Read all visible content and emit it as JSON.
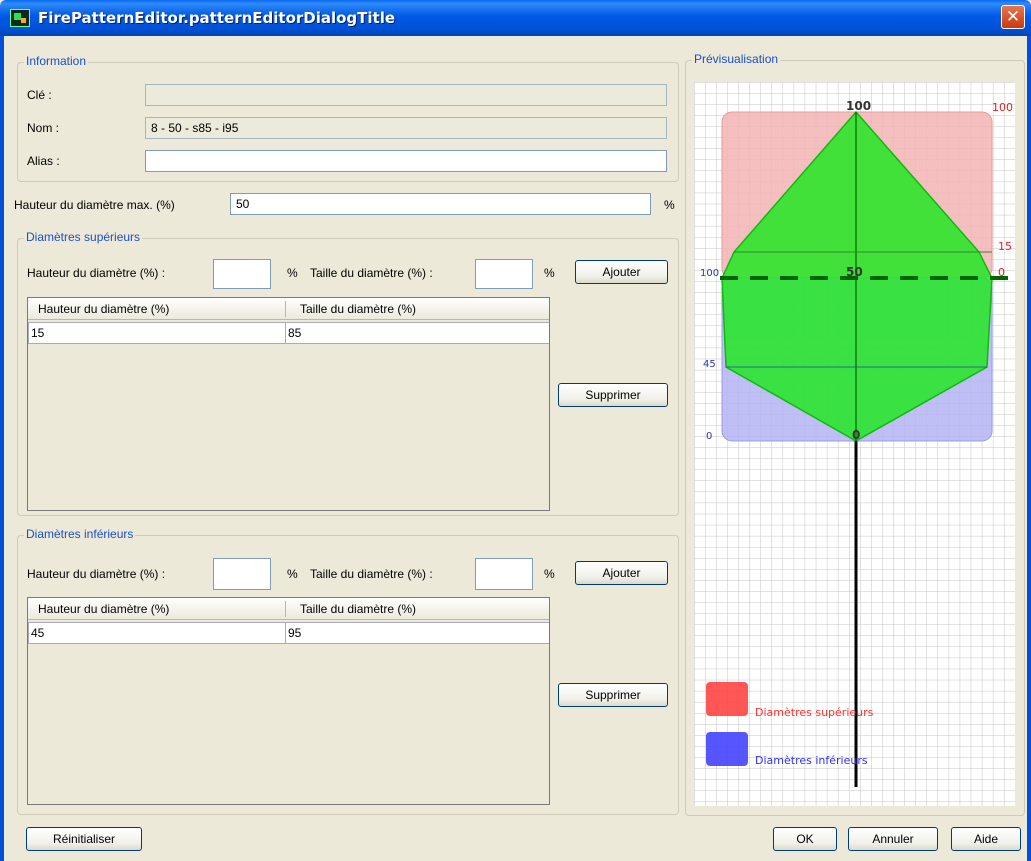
{
  "window": {
    "title": "FirePatternEditor.patternEditorDialogTitle",
    "close_glyph": "✕"
  },
  "information": {
    "group_label": "Information",
    "key_label": "Clé :",
    "key_value": "",
    "name_label": "Nom :",
    "name_value": "8 - 50 - s85 - i95",
    "alias_label": "Alias :",
    "alias_value": ""
  },
  "max_height": {
    "label": "Hauteur du diamètre max. (%)",
    "value": "50",
    "unit": "%"
  },
  "upper": {
    "group_label": "Diamètres supérieurs",
    "height_label": "Hauteur du diamètre (%) :",
    "height_value": "",
    "unit1": "%",
    "size_label": "Taille du diamètre (%) :",
    "size_value": "",
    "unit2": "%",
    "add_label": "Ajouter",
    "remove_label": "Supprimer",
    "columns": [
      "Hauteur du diamètre (%)",
      "Taille du diamètre (%)"
    ],
    "rows": [
      [
        "15",
        "85"
      ]
    ]
  },
  "lower": {
    "group_label": "Diamètres inférieurs",
    "height_label": "Hauteur du diamètre (%) :",
    "height_value": "",
    "unit1": "%",
    "size_label": "Taille du diamètre (%) :",
    "size_value": "",
    "unit2": "%",
    "add_label": "Ajouter",
    "remove_label": "Supprimer",
    "columns": [
      "Hauteur du diamètre (%)",
      "Taille du diamètre (%)"
    ],
    "rows": [
      [
        "45",
        "95"
      ]
    ]
  },
  "preview": {
    "group_label": "Prévisualisation",
    "labels": {
      "top": "100",
      "upper_top_right": "100",
      "upper_right_15": "15",
      "upper_right_0": "0",
      "mid_left": "100",
      "mid_center": "50",
      "lower_left_45": "45",
      "lower_left_0": "0",
      "bottom_center": "0"
    },
    "legend": {
      "upper_label": "Diamètres supérieurs",
      "lower_label": "Diamètres inférieurs",
      "upper_color": "#ff4444",
      "lower_color": "#4444ff"
    },
    "colors": {
      "upper_fill": "#f4b4b4",
      "lower_fill": "#b4b4f4",
      "shape_fill": "#22e622",
      "shape_stroke": "#11b811",
      "axis": "#006600",
      "stem": "#000000"
    }
  },
  "footer": {
    "reset_label": "Réinitialiser",
    "ok_label": "OK",
    "cancel_label": "Annuler",
    "help_label": "Aide"
  }
}
